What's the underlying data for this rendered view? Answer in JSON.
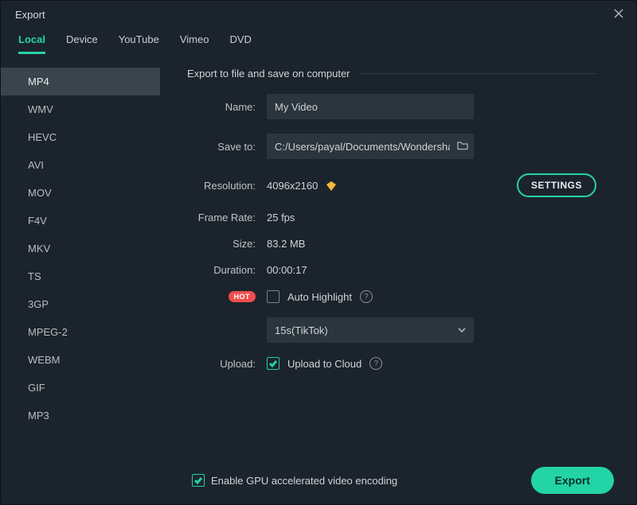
{
  "window": {
    "title": "Export"
  },
  "tabs": [
    {
      "label": "Local",
      "active": true
    },
    {
      "label": "Device"
    },
    {
      "label": "YouTube"
    },
    {
      "label": "Vimeo"
    },
    {
      "label": "DVD"
    }
  ],
  "formats": [
    {
      "label": "MP4",
      "active": true
    },
    {
      "label": "WMV"
    },
    {
      "label": "HEVC"
    },
    {
      "label": "AVI"
    },
    {
      "label": "MOV"
    },
    {
      "label": "F4V"
    },
    {
      "label": "MKV"
    },
    {
      "label": "TS"
    },
    {
      "label": "3GP"
    },
    {
      "label": "MPEG-2"
    },
    {
      "label": "WEBM"
    },
    {
      "label": "GIF"
    },
    {
      "label": "MP3"
    }
  ],
  "section": {
    "title": "Export to file and save on computer"
  },
  "fields": {
    "name_label": "Name:",
    "name_value": "My Video",
    "saveto_label": "Save to:",
    "saveto_value": "C:/Users/payal/Documents/Wondershare",
    "resolution_label": "Resolution:",
    "resolution_value": "4096x2160",
    "settings_btn": "SETTINGS",
    "framerate_label": "Frame Rate:",
    "framerate_value": "25 fps",
    "size_label": "Size:",
    "size_value": "83.2 MB",
    "duration_label": "Duration:",
    "duration_value": "00:00:17",
    "hot_badge": "HOT",
    "autohighlight_label": "Auto Highlight",
    "autohighlight_checked": false,
    "highlight_select": "15s(TikTok)",
    "upload_label": "Upload:",
    "upload_to_cloud_label": "Upload to Cloud",
    "upload_checked": true
  },
  "bottom": {
    "gpu_label": "Enable GPU accelerated video encoding",
    "gpu_checked": true,
    "export_btn": "Export"
  }
}
